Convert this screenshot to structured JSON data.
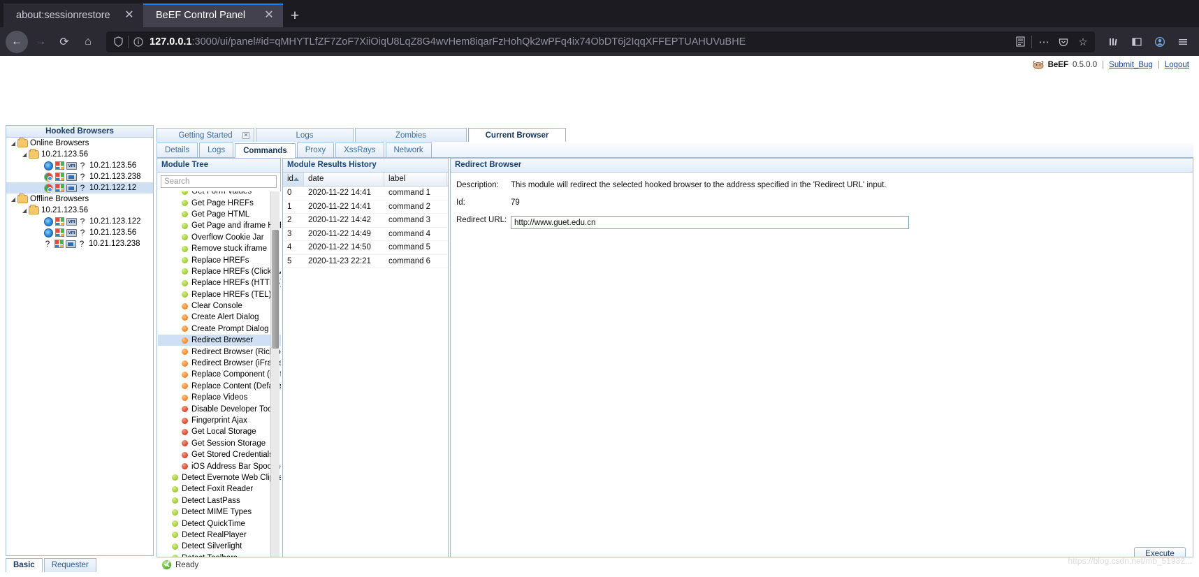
{
  "browser": {
    "tabs": [
      {
        "title": "about:sessionrestore",
        "active": false,
        "close_label": "✕"
      },
      {
        "title": "BeEF Control Panel",
        "active": true,
        "close_label": "✕"
      }
    ],
    "new_tab_label": "+",
    "nav": {
      "back_label": "←",
      "forward_label": "→",
      "reload_label": "⟳",
      "home_label": "⌂"
    },
    "url": {
      "host": "127.0.0.1",
      "rest": ":3000/ui/panel#id=qMHYTLfZF7ZoF7XiiOiqU8LqZ8G4wvHem8iqarFzHohQk2wPFq4ix74ObDT6j2IqqXFFEPTUAHUVuBHE",
      "full": "127.0.0.1:3000/ui/panel#id=qMHYTLfZF7ZoF7XiiOiqU8LqZ8G4wvHem8iqarFzHohQk2wPFq4ix74ObDT6j2IqqXFFEPTUAHUVuBHE",
      "reader_label": "☰",
      "more_label": "⋯",
      "pocket_label": "❦",
      "bookmark_label": "☆"
    },
    "toolbar_right": {
      "library_label": "ⅡⅡ",
      "sidebar_label": "▣",
      "account_label": "●",
      "menu_label": "≡"
    }
  },
  "beef_header": {
    "brand": "BeEF",
    "version": "0.5.0.0",
    "submit_bug": "Submit_Bug",
    "logout": "Logout",
    "sep": "|"
  },
  "sidebar": {
    "title": "Hooked Browsers",
    "tree": [
      {
        "type": "group",
        "depth": 0,
        "label": "Online Browsers",
        "expanded": true
      },
      {
        "type": "group",
        "depth": 1,
        "label": "10.21.123.56",
        "expanded": true
      },
      {
        "type": "host",
        "depth": 2,
        "label": "10.21.123.56",
        "browser_icon": "ie-icon",
        "os_icon": "windows-icon",
        "vm_icon": "vm-icon",
        "unknown": "?",
        "selected": false
      },
      {
        "type": "host",
        "depth": 2,
        "label": "10.21.123.238",
        "browser_icon": "chrome-icon",
        "os_icon": "windows-icon",
        "vm_icon": "monitor-icon",
        "unknown": "?",
        "selected": false
      },
      {
        "type": "host",
        "depth": 2,
        "label": "10.21.122.12",
        "browser_icon": "chrome-icon",
        "os_icon": "windows-icon",
        "vm_icon": "monitor-icon",
        "unknown": "?",
        "selected": true
      },
      {
        "type": "group",
        "depth": 0,
        "label": "Offline Browsers",
        "expanded": true
      },
      {
        "type": "group",
        "depth": 1,
        "label": "10.21.123.56",
        "expanded": true
      },
      {
        "type": "host",
        "depth": 2,
        "label": "10.21.123.122",
        "browser_icon": "ie-icon",
        "os_icon": "windows-icon",
        "vm_icon": "vm-icon",
        "unknown": "?",
        "selected": false
      },
      {
        "type": "host",
        "depth": 2,
        "label": "10.21.123.56",
        "browser_icon": "ie-icon",
        "os_icon": "windows-icon",
        "vm_icon": "vm-icon",
        "unknown": "?",
        "selected": false
      },
      {
        "type": "host",
        "depth": 2,
        "label": "10.21.123.238",
        "browser_icon": "question",
        "os_icon": "windows-icon",
        "vm_icon": "monitor-icon",
        "unknown": "?",
        "selected": false
      }
    ],
    "bottom_tabs": [
      {
        "label": "Basic",
        "active": true
      },
      {
        "label": "Requester",
        "active": false
      }
    ]
  },
  "main_tabs": [
    {
      "label": "Getting Started",
      "active": false,
      "closable": true,
      "close_label": "☒"
    },
    {
      "label": "Logs",
      "active": false,
      "closable": false
    },
    {
      "label": "Zombies",
      "active": false,
      "closable": false
    },
    {
      "label": "Current Browser",
      "active": true,
      "closable": false
    }
  ],
  "sub_tabs": [
    {
      "label": "Details",
      "active": false
    },
    {
      "label": "Logs",
      "active": false
    },
    {
      "label": "Commands",
      "active": true
    },
    {
      "label": "Proxy",
      "active": false
    },
    {
      "label": "XssRays",
      "active": false
    },
    {
      "label": "Network",
      "active": false
    }
  ],
  "module_tree": {
    "title": "Module Tree",
    "search_placeholder": "Search",
    "search_value": "",
    "items": [
      {
        "label": "Get Form Values",
        "dot": "green",
        "indent": 1,
        "selected": false,
        "clipped": true
      },
      {
        "label": "Get Page HREFs",
        "dot": "green",
        "indent": 1,
        "selected": false
      },
      {
        "label": "Get Page HTML",
        "dot": "green",
        "indent": 1,
        "selected": false
      },
      {
        "label": "Get Page and iframe HREFs",
        "dot": "green",
        "indent": 1,
        "selected": false
      },
      {
        "label": "Overflow Cookie Jar",
        "dot": "green",
        "indent": 1,
        "selected": false
      },
      {
        "label": "Remove stuck iframe",
        "dot": "green",
        "indent": 1,
        "selected": false
      },
      {
        "label": "Replace HREFs",
        "dot": "green",
        "indent": 1,
        "selected": false
      },
      {
        "label": "Replace HREFs (Click events)",
        "dot": "green",
        "indent": 1,
        "selected": false
      },
      {
        "label": "Replace HREFs (HTTPS)",
        "dot": "green",
        "indent": 1,
        "selected": false
      },
      {
        "label": "Replace HREFs (TEL)",
        "dot": "green",
        "indent": 1,
        "selected": false
      },
      {
        "label": "Clear Console",
        "dot": "orange",
        "indent": 1,
        "selected": false
      },
      {
        "label": "Create Alert Dialog",
        "dot": "orange",
        "indent": 1,
        "selected": false
      },
      {
        "label": "Create Prompt Dialog",
        "dot": "orange",
        "indent": 1,
        "selected": false
      },
      {
        "label": "Redirect Browser",
        "dot": "orange",
        "indent": 1,
        "selected": true
      },
      {
        "label": "Redirect Browser (Rickroll)",
        "dot": "orange",
        "indent": 1,
        "selected": false
      },
      {
        "label": "Redirect Browser (iFrame)",
        "dot": "orange",
        "indent": 1,
        "selected": false
      },
      {
        "label": "Replace Component (Deface)",
        "dot": "orange",
        "indent": 1,
        "selected": false
      },
      {
        "label": "Replace Content (Deface)",
        "dot": "orange",
        "indent": 1,
        "selected": false
      },
      {
        "label": "Replace Videos",
        "dot": "orange",
        "indent": 1,
        "selected": false
      },
      {
        "label": "Disable Developer Tools",
        "dot": "red",
        "indent": 1,
        "selected": false
      },
      {
        "label": "Fingerprint Ajax",
        "dot": "red",
        "indent": 1,
        "selected": false
      },
      {
        "label": "Get Local Storage",
        "dot": "red",
        "indent": 1,
        "selected": false
      },
      {
        "label": "Get Session Storage",
        "dot": "red",
        "indent": 1,
        "selected": false
      },
      {
        "label": "Get Stored Credentials",
        "dot": "red",
        "indent": 1,
        "selected": false
      },
      {
        "label": "iOS Address Bar Spoofing",
        "dot": "red",
        "indent": 1,
        "selected": false
      },
      {
        "label": "Detect Evernote Web Clipper",
        "dot": "green",
        "indent": 0,
        "selected": false
      },
      {
        "label": "Detect Foxit Reader",
        "dot": "green",
        "indent": 0,
        "selected": false
      },
      {
        "label": "Detect LastPass",
        "dot": "green",
        "indent": 0,
        "selected": false
      },
      {
        "label": "Detect MIME Types",
        "dot": "green",
        "indent": 0,
        "selected": false
      },
      {
        "label": "Detect QuickTime",
        "dot": "green",
        "indent": 0,
        "selected": false
      },
      {
        "label": "Detect RealPlayer",
        "dot": "green",
        "indent": 0,
        "selected": false
      },
      {
        "label": "Detect Silverlight",
        "dot": "green",
        "indent": 0,
        "selected": false
      },
      {
        "label": "Detect Toolbars",
        "dot": "green",
        "indent": 0,
        "selected": false
      }
    ]
  },
  "results": {
    "title": "Module Results History",
    "columns": [
      "id",
      "date",
      "label"
    ],
    "sort_column": "id",
    "sort_direction": "asc",
    "rows": [
      {
        "id": "0",
        "date": "2020-11-22 14:41",
        "label": "command 1"
      },
      {
        "id": "1",
        "date": "2020-11-22 14:41",
        "label": "command 2"
      },
      {
        "id": "2",
        "date": "2020-11-22 14:42",
        "label": "command 3"
      },
      {
        "id": "3",
        "date": "2020-11-22 14:49",
        "label": "command 4"
      },
      {
        "id": "4",
        "date": "2020-11-22 14:50",
        "label": "command 5"
      },
      {
        "id": "5",
        "date": "2020-11-23 22:21",
        "label": "command 6"
      }
    ]
  },
  "detail": {
    "title": "Redirect Browser",
    "description_label": "Description:",
    "description_value": "This module will redirect the selected hooked browser to the address specified in the 'Redirect URL' input.",
    "id_label": "Id:",
    "id_value": "79",
    "redirect_label": "Redirect URL:",
    "redirect_value": "http://www.guet.edu.cn",
    "execute_label": "Execute"
  },
  "status": {
    "text": "Ready",
    "icon": "success-check-icon"
  },
  "watermark": "https://blog.csdn.net/mb_51932...",
  "colors": {
    "accent": "#1a4477",
    "panel_border": "#a3bad4",
    "selection": "#cfe0f5",
    "dot_green": "#9ccb36",
    "dot_orange": "#f2862c",
    "dot_red": "#d9442a",
    "chrome_bg": "#2b2a33",
    "tab_active": "#42414d",
    "tab_accent": "#0a84ff"
  }
}
